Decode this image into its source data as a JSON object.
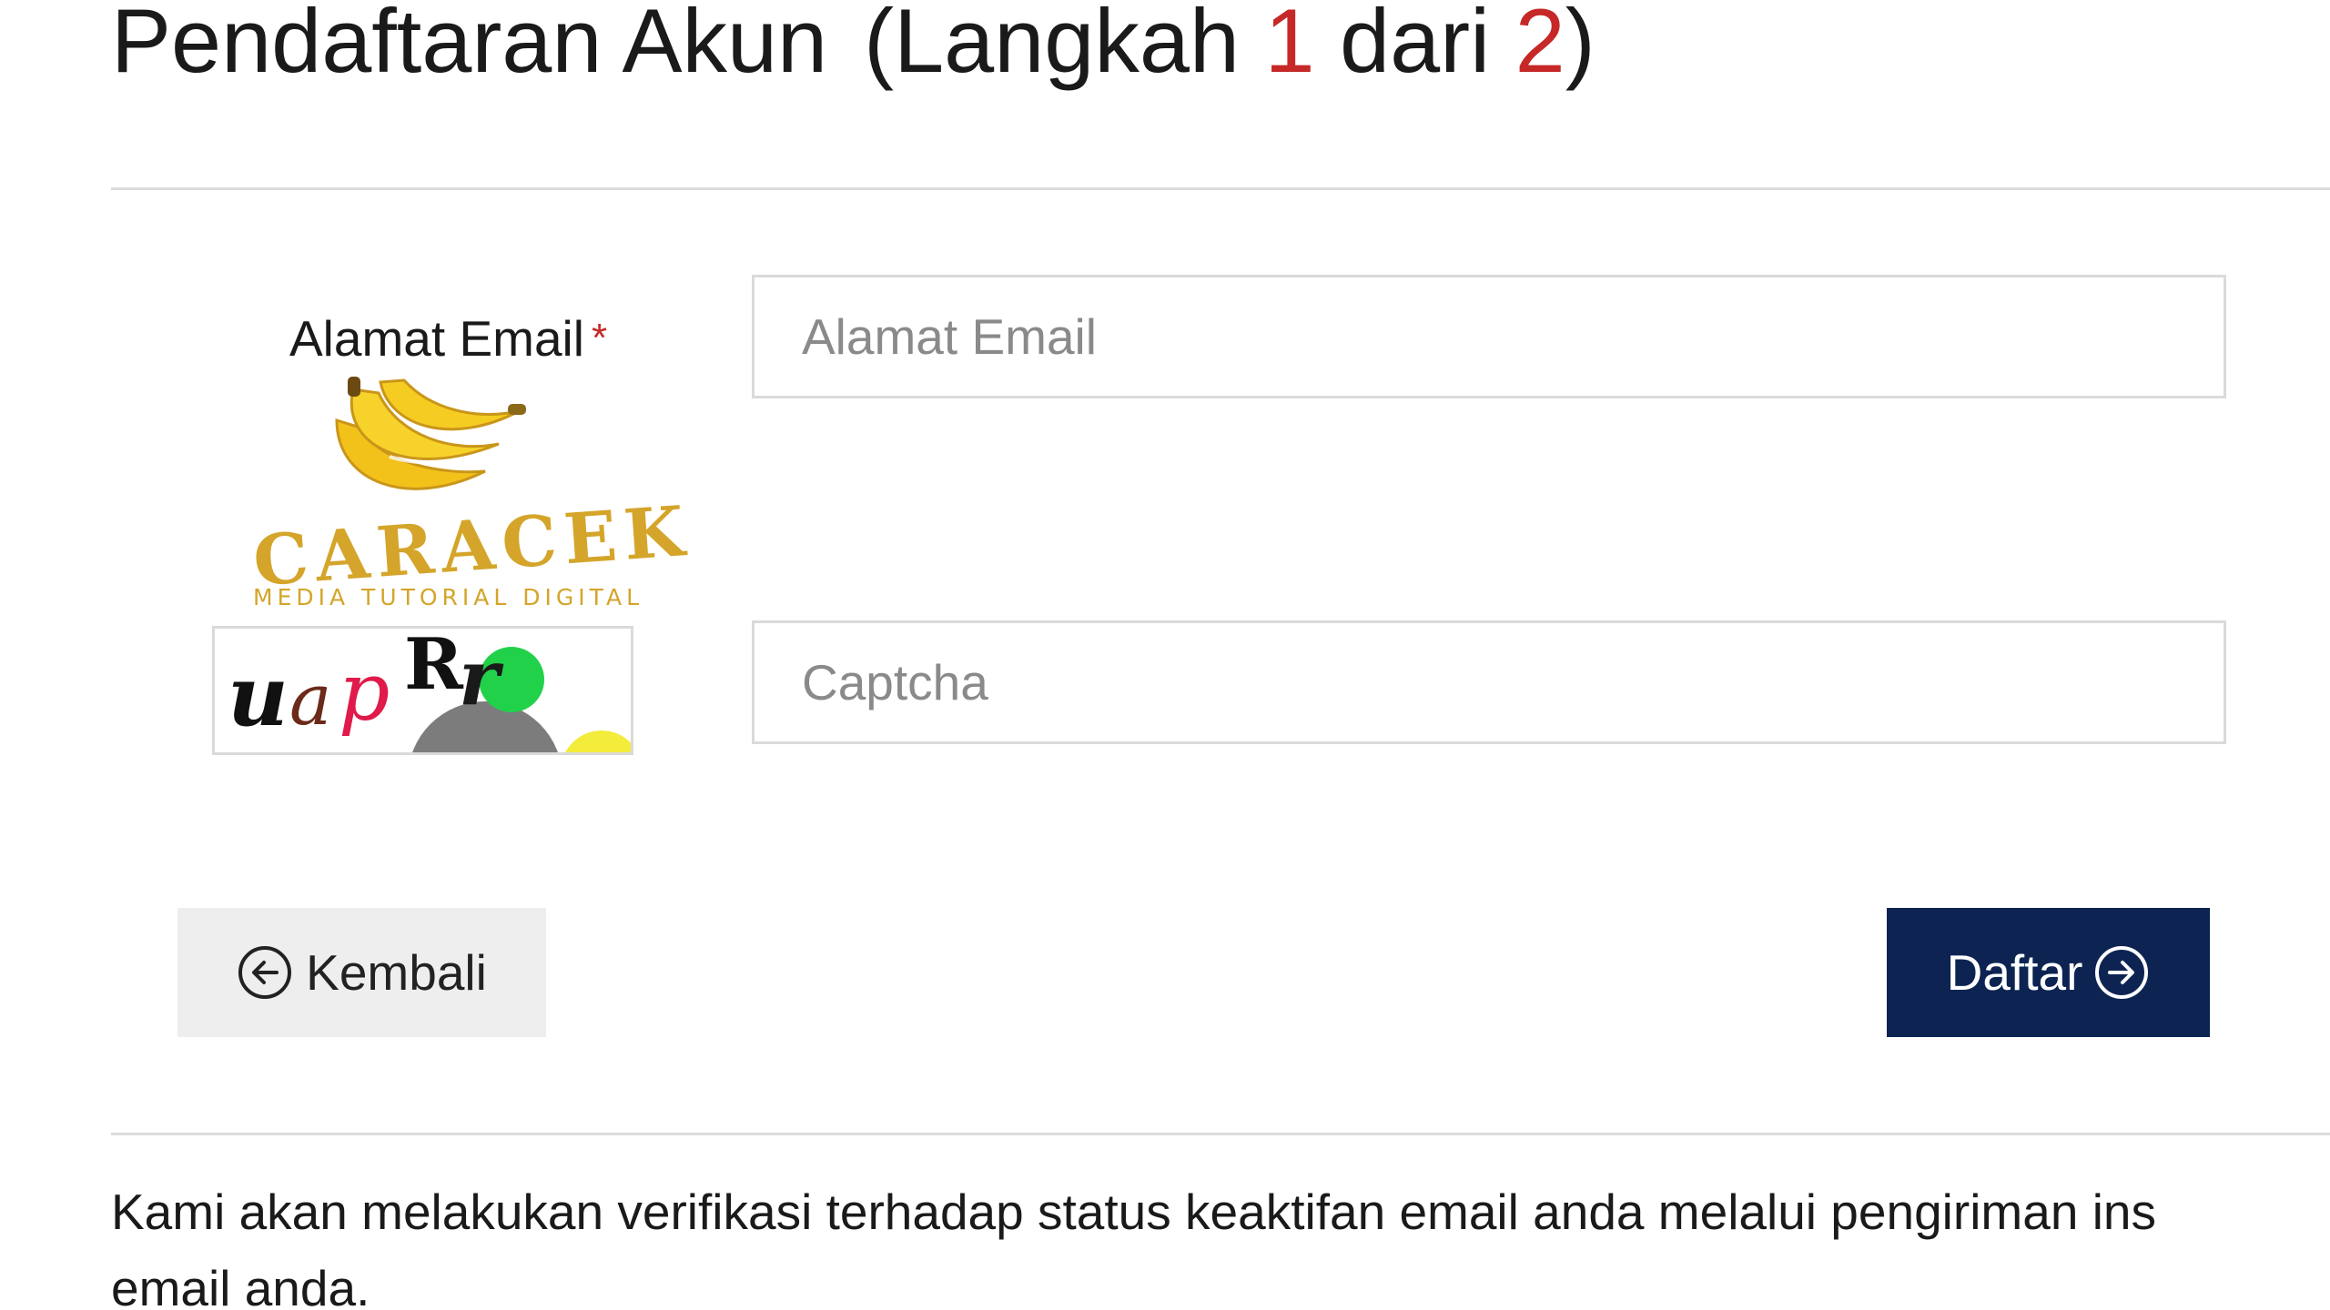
{
  "header": {
    "title_main": "Pendaftaran Akun",
    "step_open": "(Langkah",
    "step_current": "1",
    "step_middle": "dari",
    "step_total": "2",
    "step_close": ")"
  },
  "form": {
    "email_label": "Alamat Email",
    "required_mark": "*",
    "email_placeholder": "Alamat Email",
    "email_value": "",
    "captcha_placeholder": "Captcha",
    "captcha_value": "",
    "captcha_image_text": [
      "u",
      "a",
      "p",
      "R",
      "r"
    ]
  },
  "logo": {
    "brand": "CARACEK",
    "tagline": "MEDIA TUTORIAL DIGITAL"
  },
  "buttons": {
    "back_label": "Kembali",
    "submit_label": "Daftar"
  },
  "footer": {
    "note_line1": "Kami akan melakukan verifikasi terhadap status keaktifan email anda melalui pengiriman ins",
    "note_line2": "email anda."
  },
  "colors": {
    "accent_red": "#c62828",
    "primary_navy": "#0d2453",
    "logo_gold": "#d4a52a"
  }
}
